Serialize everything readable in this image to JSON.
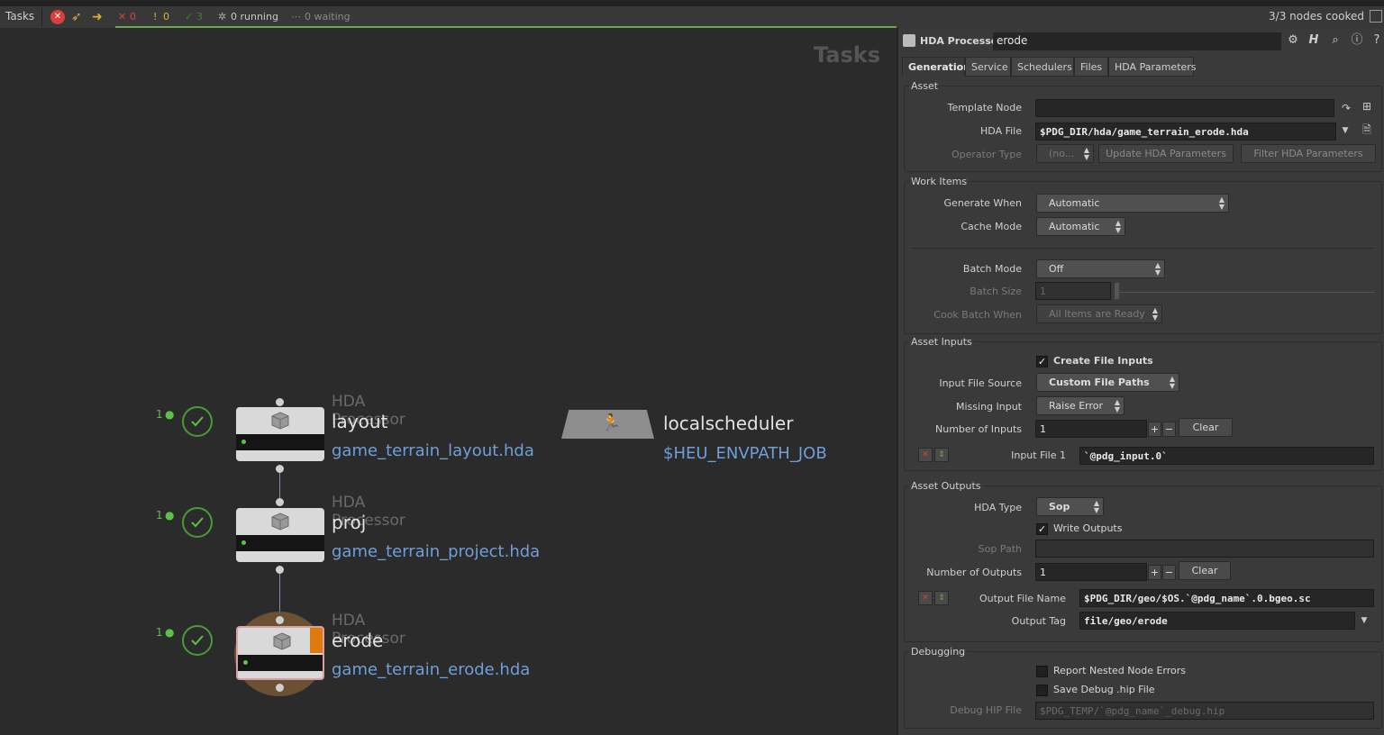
{
  "toolbar": {
    "pane_label": "Tasks",
    "failed_count": "0",
    "warning_count": "0",
    "success_count": "3",
    "running": "0 running",
    "waiting": "0 waiting",
    "nodes_cooked": "3/3 nodes cooked",
    "colors": {
      "progress": "#6aa84f",
      "error": "#d84040",
      "ok": "#5fbf4a"
    }
  },
  "canvas": {
    "title": "Tasks",
    "nodes": [
      {
        "count": "1",
        "type": "HDA Processor",
        "name": "layout",
        "file": "game_terrain_layout.hda"
      },
      {
        "count": "1",
        "type": "HDA Processor",
        "name": "proj",
        "file": "game_terrain_project.hda"
      },
      {
        "count": "1",
        "type": "HDA Processor",
        "name": "erode",
        "file": "game_terrain_erode.hda"
      }
    ],
    "scheduler": {
      "name": "localscheduler",
      "path": "$HEU_ENVPATH_JOB"
    }
  },
  "panel": {
    "node_type": "HDA Processor",
    "node_name": "erode",
    "tabs": [
      "Generation",
      "Service",
      "Schedulers",
      "Files",
      "HDA Parameters"
    ],
    "asset": {
      "title": "Asset",
      "template_node_label": "Template Node",
      "template_node_value": "",
      "hda_file_label": "HDA File",
      "hda_file_value": "$PDG_DIR/hda/game_terrain_erode.hda",
      "operator_type_label": "Operator Type",
      "operator_type_value": "(no...",
      "update_button": "Update HDA Parameters",
      "filter_button": "Filter HDA Parameters"
    },
    "work_items": {
      "title": "Work Items",
      "generate_when_label": "Generate When",
      "generate_when_value": "Automatic",
      "cache_mode_label": "Cache Mode",
      "cache_mode_value": "Automatic",
      "batch_mode_label": "Batch Mode",
      "batch_mode_value": "Off",
      "batch_size_label": "Batch Size",
      "batch_size_value": "1",
      "cook_batch_label": "Cook Batch When",
      "cook_batch_value": "All Items are Ready"
    },
    "asset_inputs": {
      "title": "Asset Inputs",
      "create_file_inputs": "Create File Inputs",
      "input_file_source_label": "Input File Source",
      "input_file_source_value": "Custom File Paths",
      "missing_input_label": "Missing Input",
      "missing_input_value": "Raise Error",
      "num_inputs_label": "Number of Inputs",
      "num_inputs_value": "1",
      "clear_label": "Clear",
      "input_file_label": "Input File 1",
      "input_file_value": "`@pdg_input.0`"
    },
    "asset_outputs": {
      "title": "Asset Outputs",
      "hda_type_label": "HDA Type",
      "hda_type_value": "Sop",
      "write_outputs": "Write Outputs",
      "sop_path_label": "Sop Path",
      "sop_path_value": "",
      "num_outputs_label": "Number of Outputs",
      "num_outputs_value": "1",
      "clear_label": "Clear",
      "output_file_label": "Output File Name",
      "output_file_value": "$PDG_DIR/geo/$OS.`@pdg_name`.0.bgeo.sc",
      "output_tag_label": "Output Tag",
      "output_tag_value": "file/geo/erode"
    },
    "debugging": {
      "title": "Debugging",
      "report_nested": "Report Nested Node Errors",
      "save_debug": "Save Debug .hip File",
      "debug_hip_label": "Debug HIP File",
      "debug_hip_value": "$PDG_TEMP/`@pdg_name`_debug.hip"
    }
  }
}
